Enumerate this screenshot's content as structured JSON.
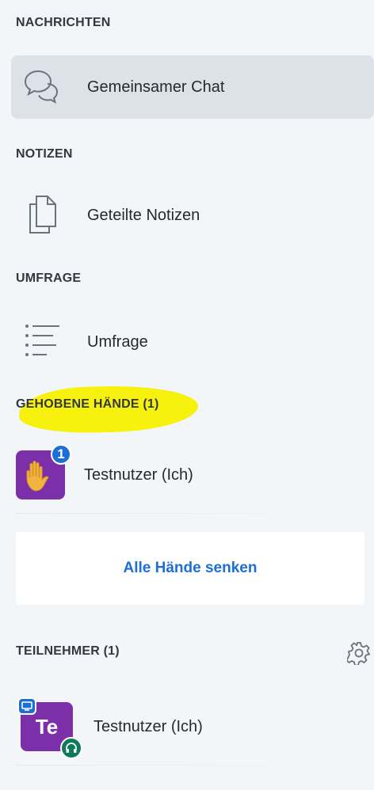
{
  "sections": {
    "messages": {
      "title": "NACHRICHTEN",
      "items": [
        {
          "label": "Gemeinsamer Chat",
          "icon": "chat-bubbles-icon",
          "active": true
        }
      ]
    },
    "notes": {
      "title": "NOTIZEN",
      "items": [
        {
          "label": "Geteilte Notizen",
          "icon": "documents-icon"
        }
      ]
    },
    "poll": {
      "title": "UMFRAGE",
      "items": [
        {
          "label": "Umfrage",
          "icon": "list-icon"
        }
      ]
    },
    "raised_hands": {
      "title": "GEHOBENE HÄNDE",
      "count": "(1)",
      "highlight_color": "#f5f100",
      "users": [
        {
          "name": "Testnutzer (Ich)",
          "badge": "1",
          "icon": "raised-hand-icon",
          "avatar_color": "#7b2fa8"
        }
      ],
      "lower_all_label": "Alle Hände senken"
    },
    "participants": {
      "title": "TEILNEHMER",
      "count": "(1)",
      "settings_icon": "gear-icon",
      "users": [
        {
          "name": "Testnutzer (Ich)",
          "initials": "Te",
          "avatar_color": "#7b2fa8",
          "status_icons": [
            "monitor-icon",
            "headset-icon"
          ]
        }
      ]
    }
  },
  "colors": {
    "accent": "#1b6fd6",
    "background": "#f3f6f9",
    "active_item": "#dde2e8",
    "avatar": "#7b2fa8",
    "audio_status": "#0f7a5a"
  }
}
